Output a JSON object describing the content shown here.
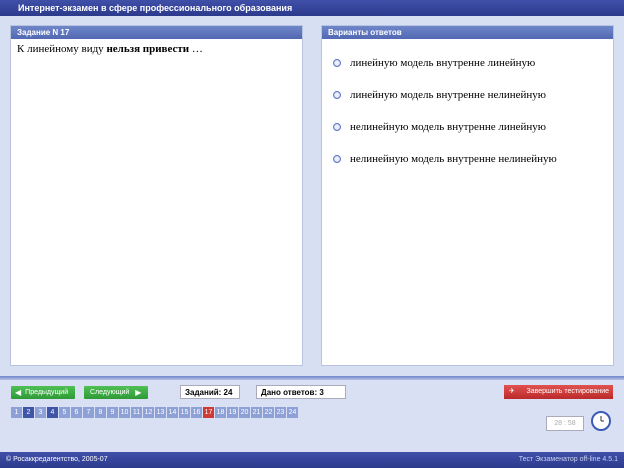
{
  "app": {
    "title": "Интернет-экзамен в сфере профессионального образования"
  },
  "question_panel": {
    "header": "Задание N 17",
    "text_prefix": "К линейному виду ",
    "text_bold": "нельзя привести",
    "text_suffix": " …"
  },
  "answers_panel": {
    "header": "Варианты ответов",
    "options": [
      "линейную модель внутренне линейную",
      "линейную модель внутренне нелинейную",
      "нелинейную модель внутренне линейную",
      "нелинейную модель внутренне нелинейную"
    ]
  },
  "navigation": {
    "prev_label": "Предыдущий",
    "next_label": "Следующий",
    "tasks_count_label": "Заданий: 24",
    "answers_given_label": "Дано ответов: 3",
    "finish_label": "Завершить тестирование"
  },
  "tasks": {
    "numbers": [
      "1",
      "2",
      "3",
      "4",
      "5",
      "6",
      "7",
      "8",
      "9",
      "10",
      "11",
      "12",
      "13",
      "14",
      "15",
      "16",
      "17",
      "18",
      "19",
      "20",
      "21",
      "22",
      "23",
      "24"
    ],
    "current": "17",
    "answered": [
      "2",
      "4"
    ]
  },
  "timer": {
    "value": "28 : 58"
  },
  "statusbar": {
    "left": "© Росаккредагентство, 2005-07",
    "right": "Тест Экзаменатор off-line 4.5.1"
  },
  "colors": {
    "accent": "#3e55a8",
    "nav_green": "#2e9a36",
    "finish_red": "#bb2a2a",
    "current_task": "#d03a34"
  }
}
